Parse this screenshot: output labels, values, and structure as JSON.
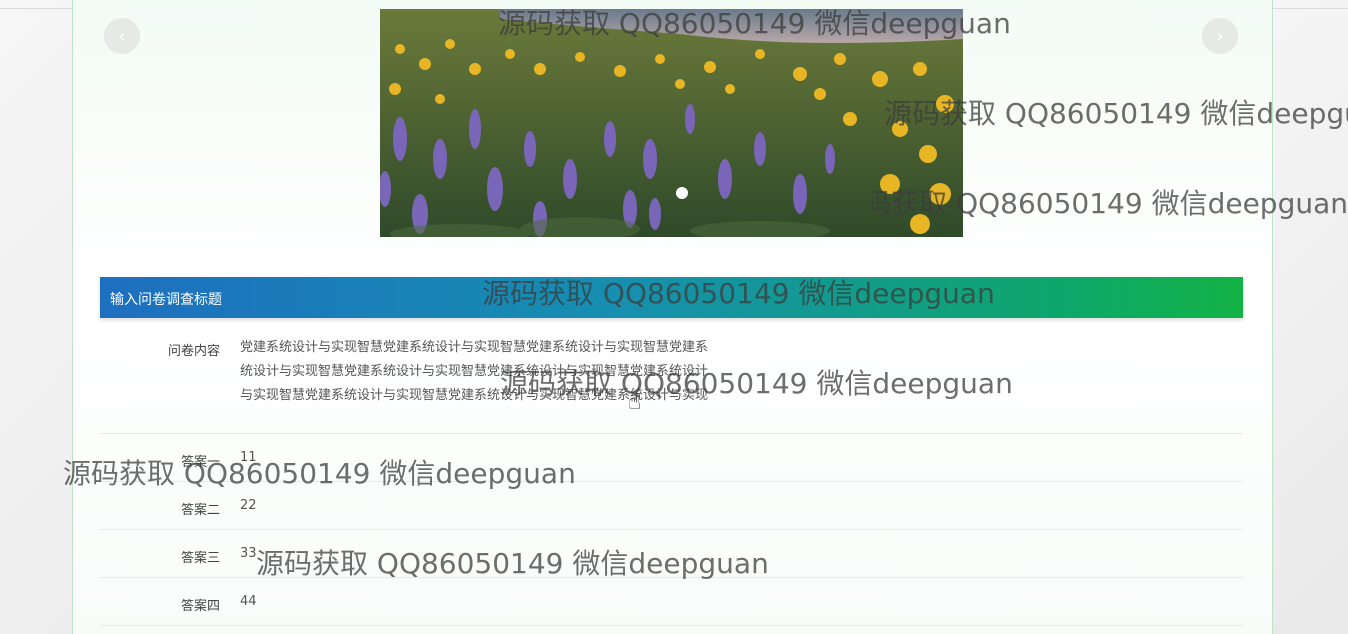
{
  "carousel": {
    "prev_label": "‹",
    "next_label": "›"
  },
  "survey": {
    "title": "输入问卷调查标题",
    "content_label": "问卷内容",
    "content_text": "党建系统设计与实现智慧党建系统设计与实现智慧党建系统设计与实现智慧党建系统设计与实现智慧党建系统设计与实现智慧党建系统设计与实现智慧党建系统设计与实现智慧党建系统设计与实现智慧党建系统设计与实现智慧党建系统设计与实现",
    "answers": [
      {
        "label": "答案一",
        "value": "11"
      },
      {
        "label": "答案二",
        "value": "22"
      },
      {
        "label": "答案三",
        "value": "33"
      },
      {
        "label": "答案四",
        "value": "44"
      }
    ]
  },
  "watermark": "源码获取 QQ86050149 微信deepguan"
}
